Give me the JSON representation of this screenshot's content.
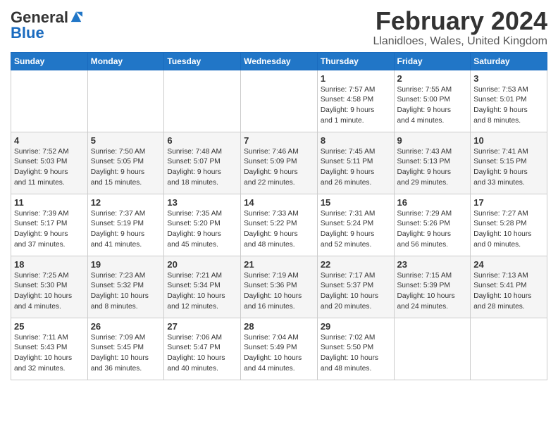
{
  "header": {
    "logo_general": "General",
    "logo_blue": "Blue",
    "month_title": "February 2024",
    "location": "Llanidloes, Wales, United Kingdom"
  },
  "weekdays": [
    "Sunday",
    "Monday",
    "Tuesday",
    "Wednesday",
    "Thursday",
    "Friday",
    "Saturday"
  ],
  "weeks": [
    [
      {
        "day": "",
        "info": ""
      },
      {
        "day": "",
        "info": ""
      },
      {
        "day": "",
        "info": ""
      },
      {
        "day": "",
        "info": ""
      },
      {
        "day": "1",
        "info": "Sunrise: 7:57 AM\nSunset: 4:58 PM\nDaylight: 9 hours\nand 1 minute."
      },
      {
        "day": "2",
        "info": "Sunrise: 7:55 AM\nSunset: 5:00 PM\nDaylight: 9 hours\nand 4 minutes."
      },
      {
        "day": "3",
        "info": "Sunrise: 7:53 AM\nSunset: 5:01 PM\nDaylight: 9 hours\nand 8 minutes."
      }
    ],
    [
      {
        "day": "4",
        "info": "Sunrise: 7:52 AM\nSunset: 5:03 PM\nDaylight: 9 hours\nand 11 minutes."
      },
      {
        "day": "5",
        "info": "Sunrise: 7:50 AM\nSunset: 5:05 PM\nDaylight: 9 hours\nand 15 minutes."
      },
      {
        "day": "6",
        "info": "Sunrise: 7:48 AM\nSunset: 5:07 PM\nDaylight: 9 hours\nand 18 minutes."
      },
      {
        "day": "7",
        "info": "Sunrise: 7:46 AM\nSunset: 5:09 PM\nDaylight: 9 hours\nand 22 minutes."
      },
      {
        "day": "8",
        "info": "Sunrise: 7:45 AM\nSunset: 5:11 PM\nDaylight: 9 hours\nand 26 minutes."
      },
      {
        "day": "9",
        "info": "Sunrise: 7:43 AM\nSunset: 5:13 PM\nDaylight: 9 hours\nand 29 minutes."
      },
      {
        "day": "10",
        "info": "Sunrise: 7:41 AM\nSunset: 5:15 PM\nDaylight: 9 hours\nand 33 minutes."
      }
    ],
    [
      {
        "day": "11",
        "info": "Sunrise: 7:39 AM\nSunset: 5:17 PM\nDaylight: 9 hours\nand 37 minutes."
      },
      {
        "day": "12",
        "info": "Sunrise: 7:37 AM\nSunset: 5:19 PM\nDaylight: 9 hours\nand 41 minutes."
      },
      {
        "day": "13",
        "info": "Sunrise: 7:35 AM\nSunset: 5:20 PM\nDaylight: 9 hours\nand 45 minutes."
      },
      {
        "day": "14",
        "info": "Sunrise: 7:33 AM\nSunset: 5:22 PM\nDaylight: 9 hours\nand 48 minutes."
      },
      {
        "day": "15",
        "info": "Sunrise: 7:31 AM\nSunset: 5:24 PM\nDaylight: 9 hours\nand 52 minutes."
      },
      {
        "day": "16",
        "info": "Sunrise: 7:29 AM\nSunset: 5:26 PM\nDaylight: 9 hours\nand 56 minutes."
      },
      {
        "day": "17",
        "info": "Sunrise: 7:27 AM\nSunset: 5:28 PM\nDaylight: 10 hours\nand 0 minutes."
      }
    ],
    [
      {
        "day": "18",
        "info": "Sunrise: 7:25 AM\nSunset: 5:30 PM\nDaylight: 10 hours\nand 4 minutes."
      },
      {
        "day": "19",
        "info": "Sunrise: 7:23 AM\nSunset: 5:32 PM\nDaylight: 10 hours\nand 8 minutes."
      },
      {
        "day": "20",
        "info": "Sunrise: 7:21 AM\nSunset: 5:34 PM\nDaylight: 10 hours\nand 12 minutes."
      },
      {
        "day": "21",
        "info": "Sunrise: 7:19 AM\nSunset: 5:36 PM\nDaylight: 10 hours\nand 16 minutes."
      },
      {
        "day": "22",
        "info": "Sunrise: 7:17 AM\nSunset: 5:37 PM\nDaylight: 10 hours\nand 20 minutes."
      },
      {
        "day": "23",
        "info": "Sunrise: 7:15 AM\nSunset: 5:39 PM\nDaylight: 10 hours\nand 24 minutes."
      },
      {
        "day": "24",
        "info": "Sunrise: 7:13 AM\nSunset: 5:41 PM\nDaylight: 10 hours\nand 28 minutes."
      }
    ],
    [
      {
        "day": "25",
        "info": "Sunrise: 7:11 AM\nSunset: 5:43 PM\nDaylight: 10 hours\nand 32 minutes."
      },
      {
        "day": "26",
        "info": "Sunrise: 7:09 AM\nSunset: 5:45 PM\nDaylight: 10 hours\nand 36 minutes."
      },
      {
        "day": "27",
        "info": "Sunrise: 7:06 AM\nSunset: 5:47 PM\nDaylight: 10 hours\nand 40 minutes."
      },
      {
        "day": "28",
        "info": "Sunrise: 7:04 AM\nSunset: 5:49 PM\nDaylight: 10 hours\nand 44 minutes."
      },
      {
        "day": "29",
        "info": "Sunrise: 7:02 AM\nSunset: 5:50 PM\nDaylight: 10 hours\nand 48 minutes."
      },
      {
        "day": "",
        "info": ""
      },
      {
        "day": "",
        "info": ""
      }
    ]
  ]
}
